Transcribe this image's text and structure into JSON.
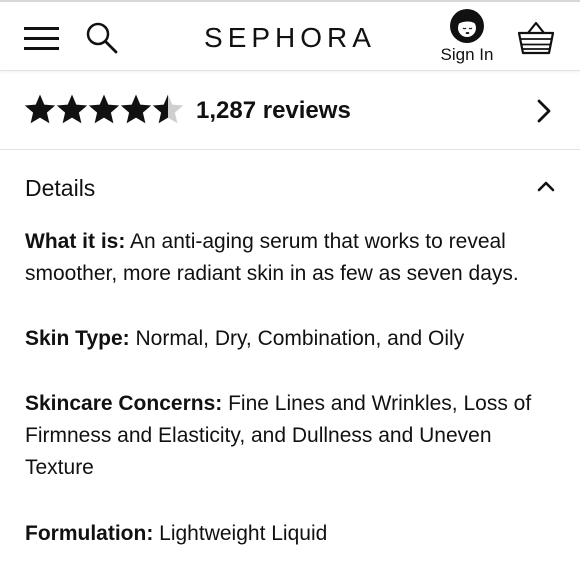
{
  "header": {
    "logo_text": "SEPHORA",
    "menu_icon": "hamburger-menu-icon",
    "search_icon": "search-icon",
    "signin_label": "Sign In",
    "signin_icon": "user-avatar-icon",
    "basket_icon": "shopping-basket-icon"
  },
  "reviews": {
    "rating": 4.5,
    "rating_max": 5,
    "count_text": "1,287 reviews",
    "chevron_icon": "chevron-right-icon"
  },
  "details": {
    "title": "Details",
    "chevron_icon": "chevron-up-icon",
    "items": [
      {
        "label": "What it is:",
        "value": " An anti-aging serum that works to reveal smoother, more radiant skin in as few as seven days."
      },
      {
        "label": "Skin Type:",
        "value": " Normal, Dry, Combination, and Oily"
      },
      {
        "label": "Skincare Concerns:",
        "value": " Fine Lines and Wrinkles, Loss of Firmness and Elasticity, and Dullness and Uneven Texture"
      },
      {
        "label": "Formulation:",
        "value": " Lightweight Liquid"
      }
    ]
  },
  "colors": {
    "text": "#111111",
    "star_filled": "#111111",
    "star_empty": "#cfcfcf",
    "divider": "#e3e3e3"
  }
}
